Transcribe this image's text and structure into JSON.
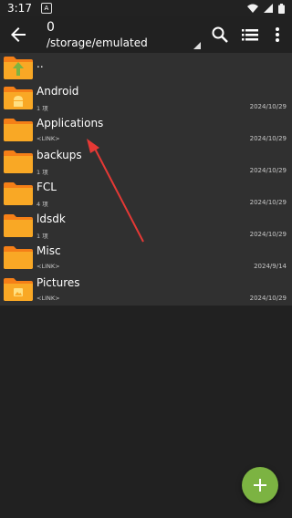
{
  "status_bar": {
    "time": "3:17",
    "notification_badge": "A"
  },
  "toolbar": {
    "count": "0",
    "path": "/storage/emulated"
  },
  "parent": {
    "label": ".."
  },
  "files": [
    {
      "name": "Android",
      "sub": "1 项",
      "date": "2024/10/29",
      "overlay": "android"
    },
    {
      "name": "Applications",
      "sub": "<LINK>",
      "date": "2024/10/29",
      "overlay": ""
    },
    {
      "name": "backups",
      "sub": "1 项",
      "date": "2024/10/29",
      "overlay": ""
    },
    {
      "name": "FCL",
      "sub": "4 项",
      "date": "2024/10/29",
      "overlay": ""
    },
    {
      "name": "ldsdk",
      "sub": "1 项",
      "date": "2024/10/29",
      "overlay": ""
    },
    {
      "name": "Misc",
      "sub": "<LINK>",
      "date": "2024/9/14",
      "overlay": ""
    },
    {
      "name": "Pictures",
      "sub": "<LINK>",
      "date": "2024/10/29",
      "overlay": "picture"
    }
  ],
  "colors": {
    "folder": "#F9A825",
    "folder_tab": "#F57F17",
    "fab": "#7CB342",
    "annotation_arrow": "#E53935"
  },
  "icons": [
    "back-arrow-icon",
    "search-icon",
    "list-view-icon",
    "more-vert-icon",
    "add-icon",
    "wifi-icon",
    "signal-icon",
    "battery-icon"
  ]
}
